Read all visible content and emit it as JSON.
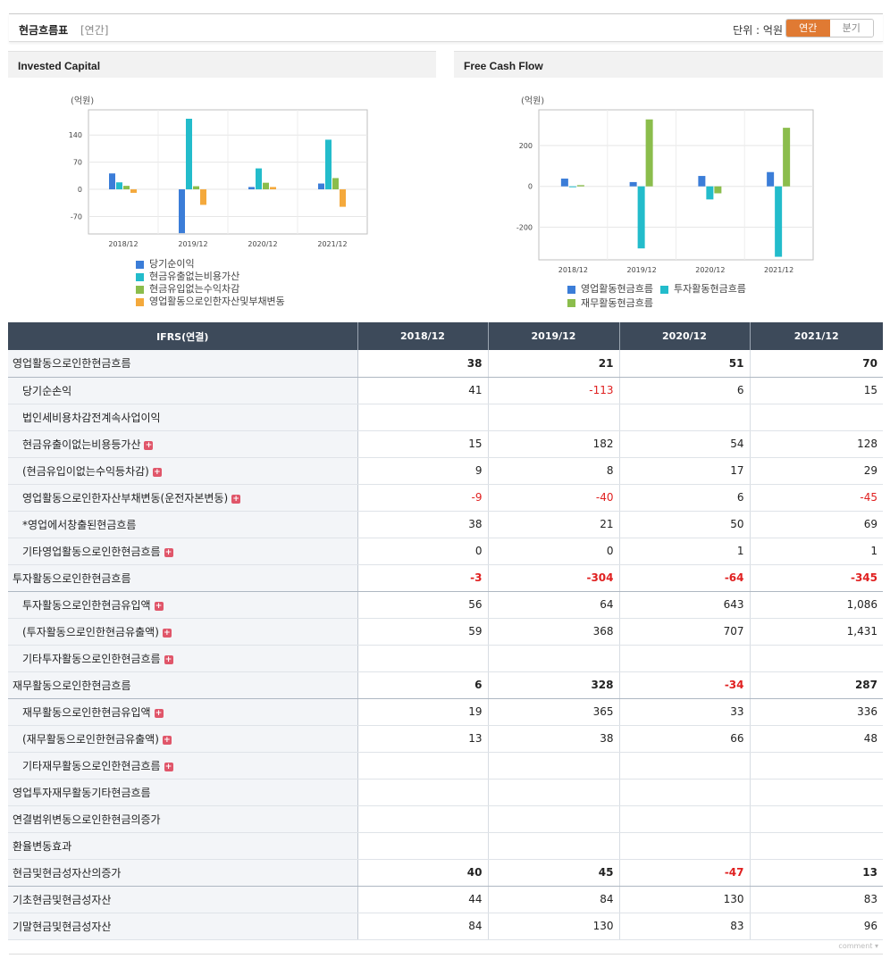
{
  "header": {
    "title": "현금흐름표",
    "period": "[연간]",
    "unit": "단위 : 억원",
    "toggle_annual": "연간",
    "toggle_quarter": "분기"
  },
  "colors": {
    "blue": "#3b7dd8",
    "cyan": "#23bccb",
    "green": "#8bbd4c",
    "orange": "#f4a93c",
    "accent": "#e07a33"
  },
  "charts": {
    "invested": {
      "title": "Invested Capital",
      "unit": "(억원)",
      "chart_data": {
        "type": "bar",
        "categories": [
          "2018/12",
          "2019/12",
          "2020/12",
          "2021/12"
        ],
        "yticks": [
          140,
          70,
          0,
          -70
        ],
        "ylim": [
          -115,
          205
        ],
        "series": [
          {
            "name": "당기순이익",
            "color": "#3b7dd8",
            "values": [
              41,
              -113,
              6,
              15
            ]
          },
          {
            "name": "현금유출없는비용가산",
            "color": "#23bccb",
            "values": [
              18,
              182,
              54,
              128
            ]
          },
          {
            "name": "현금유입없는수익차감",
            "color": "#8bbd4c",
            "values": [
              9,
              8,
              17,
              29
            ]
          },
          {
            "name": "영업활동으로인한자산및부채변동",
            "color": "#f4a93c",
            "values": [
              -9,
              -40,
              6,
              -45
            ]
          }
        ]
      }
    },
    "fcf": {
      "title": "Free Cash Flow",
      "unit": "(억원)",
      "chart_data": {
        "type": "bar",
        "categories": [
          "2018/12",
          "2019/12",
          "2020/12",
          "2021/12"
        ],
        "yticks": [
          200,
          0,
          -200
        ],
        "ylim": [
          -360,
          375
        ],
        "series": [
          {
            "name": "영업활동현금흐름",
            "color": "#3b7dd8",
            "values": [
              38,
              21,
              51,
              70
            ]
          },
          {
            "name": "투자활동현금흐름",
            "color": "#23bccb",
            "values": [
              -3,
              -304,
              -64,
              -345
            ]
          },
          {
            "name": "재무활동현금흐름",
            "color": "#8bbd4c",
            "values": [
              6,
              328,
              -34,
              287
            ]
          }
        ]
      }
    }
  },
  "table": {
    "head": [
      "IFRS(연결)",
      "2018/12",
      "2019/12",
      "2020/12",
      "2021/12"
    ],
    "rows": [
      {
        "label": "영업활동으로인한현금흐름",
        "vals": [
          "38",
          "21",
          "51",
          "70"
        ],
        "major": true,
        "sub": false,
        "plus": false
      },
      {
        "label": "당기순손익",
        "vals": [
          "41",
          "-113",
          "6",
          "15"
        ],
        "major": false,
        "sub": true,
        "plus": false
      },
      {
        "label": "법인세비용차감전계속사업이익",
        "vals": [
          "",
          "",
          "",
          ""
        ],
        "major": false,
        "sub": true,
        "plus": false
      },
      {
        "label": "현금유출이없는비용등가산",
        "vals": [
          "15",
          "182",
          "54",
          "128"
        ],
        "major": false,
        "sub": true,
        "plus": true
      },
      {
        "label": "(현금유입이없는수익등차감)",
        "vals": [
          "9",
          "8",
          "17",
          "29"
        ],
        "major": false,
        "sub": true,
        "plus": true
      },
      {
        "label": "영업활동으로인한자산부채변동(운전자본변동)",
        "vals": [
          "-9",
          "-40",
          "6",
          "-45"
        ],
        "major": false,
        "sub": true,
        "plus": true
      },
      {
        "label": "*영업에서창출된현금흐름",
        "vals": [
          "38",
          "21",
          "50",
          "69"
        ],
        "major": false,
        "sub": true,
        "plus": false
      },
      {
        "label": "기타영업활동으로인한현금흐름",
        "vals": [
          "0",
          "0",
          "1",
          "1"
        ],
        "major": false,
        "sub": true,
        "plus": true
      },
      {
        "label": "투자활동으로인한현금흐름",
        "vals": [
          "-3",
          "-304",
          "-64",
          "-345"
        ],
        "major": true,
        "sub": false,
        "plus": false
      },
      {
        "label": "투자활동으로인한현금유입액",
        "vals": [
          "56",
          "64",
          "643",
          "1,086"
        ],
        "major": false,
        "sub": true,
        "plus": true
      },
      {
        "label": "(투자활동으로인한현금유출액)",
        "vals": [
          "59",
          "368",
          "707",
          "1,431"
        ],
        "major": false,
        "sub": true,
        "plus": true
      },
      {
        "label": "기타투자활동으로인한현금흐름",
        "vals": [
          "",
          "",
          "",
          ""
        ],
        "major": false,
        "sub": true,
        "plus": true
      },
      {
        "label": "재무활동으로인한현금흐름",
        "vals": [
          "6",
          "328",
          "-34",
          "287"
        ],
        "major": true,
        "sub": false,
        "plus": false
      },
      {
        "label": "재무활동으로인한현금유입액",
        "vals": [
          "19",
          "365",
          "33",
          "336"
        ],
        "major": false,
        "sub": true,
        "plus": true
      },
      {
        "label": "(재무활동으로인한현금유출액)",
        "vals": [
          "13",
          "38",
          "66",
          "48"
        ],
        "major": false,
        "sub": true,
        "plus": true
      },
      {
        "label": "기타재무활동으로인한현금흐름",
        "vals": [
          "",
          "",
          "",
          ""
        ],
        "major": false,
        "sub": true,
        "plus": true
      },
      {
        "label": "영업투자재무활동기타현금흐름",
        "vals": [
          "",
          "",
          "",
          ""
        ],
        "major": false,
        "sub": false,
        "plus": false
      },
      {
        "label": "연결범위변동으로인한현금의증가",
        "vals": [
          "",
          "",
          "",
          ""
        ],
        "major": false,
        "sub": false,
        "plus": false
      },
      {
        "label": "환율변동효과",
        "vals": [
          "",
          "",
          "",
          ""
        ],
        "major": false,
        "sub": false,
        "plus": false
      },
      {
        "label": "현금및현금성자산의증가",
        "vals": [
          "40",
          "45",
          "-47",
          "13"
        ],
        "major": true,
        "sub": false,
        "plus": false
      },
      {
        "label": "기초현금및현금성자산",
        "vals": [
          "44",
          "84",
          "130",
          "83"
        ],
        "major": false,
        "sub": false,
        "plus": false
      },
      {
        "label": "기말현금및현금성자산",
        "vals": [
          "84",
          "130",
          "83",
          "96"
        ],
        "major": false,
        "sub": false,
        "plus": false
      }
    ]
  },
  "footer": {
    "comment": "comment ▾"
  }
}
